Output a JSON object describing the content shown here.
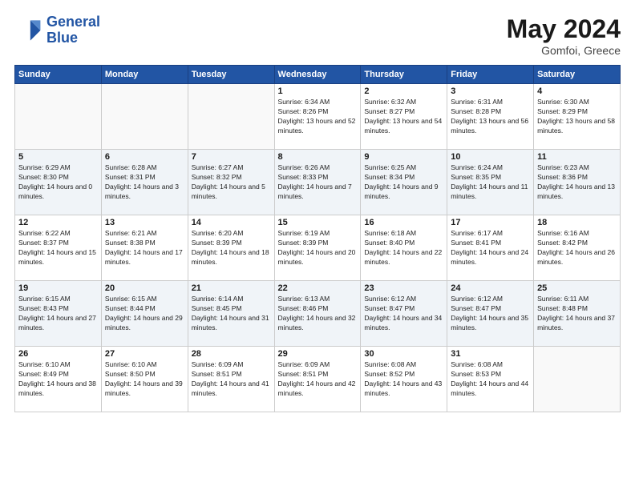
{
  "header": {
    "logo_line1": "General",
    "logo_line2": "Blue",
    "month_year": "May 2024",
    "location": "Gomfoi, Greece"
  },
  "days_of_week": [
    "Sunday",
    "Monday",
    "Tuesday",
    "Wednesday",
    "Thursday",
    "Friday",
    "Saturday"
  ],
  "weeks": [
    [
      {
        "day": "",
        "sunrise": "",
        "sunset": "",
        "daylight": "",
        "empty": true
      },
      {
        "day": "",
        "sunrise": "",
        "sunset": "",
        "daylight": "",
        "empty": true
      },
      {
        "day": "",
        "sunrise": "",
        "sunset": "",
        "daylight": "",
        "empty": true
      },
      {
        "day": "1",
        "sunrise": "Sunrise: 6:34 AM",
        "sunset": "Sunset: 8:26 PM",
        "daylight": "Daylight: 13 hours and 52 minutes."
      },
      {
        "day": "2",
        "sunrise": "Sunrise: 6:32 AM",
        "sunset": "Sunset: 8:27 PM",
        "daylight": "Daylight: 13 hours and 54 minutes."
      },
      {
        "day": "3",
        "sunrise": "Sunrise: 6:31 AM",
        "sunset": "Sunset: 8:28 PM",
        "daylight": "Daylight: 13 hours and 56 minutes."
      },
      {
        "day": "4",
        "sunrise": "Sunrise: 6:30 AM",
        "sunset": "Sunset: 8:29 PM",
        "daylight": "Daylight: 13 hours and 58 minutes."
      }
    ],
    [
      {
        "day": "5",
        "sunrise": "Sunrise: 6:29 AM",
        "sunset": "Sunset: 8:30 PM",
        "daylight": "Daylight: 14 hours and 0 minutes."
      },
      {
        "day": "6",
        "sunrise": "Sunrise: 6:28 AM",
        "sunset": "Sunset: 8:31 PM",
        "daylight": "Daylight: 14 hours and 3 minutes."
      },
      {
        "day": "7",
        "sunrise": "Sunrise: 6:27 AM",
        "sunset": "Sunset: 8:32 PM",
        "daylight": "Daylight: 14 hours and 5 minutes."
      },
      {
        "day": "8",
        "sunrise": "Sunrise: 6:26 AM",
        "sunset": "Sunset: 8:33 PM",
        "daylight": "Daylight: 14 hours and 7 minutes."
      },
      {
        "day": "9",
        "sunrise": "Sunrise: 6:25 AM",
        "sunset": "Sunset: 8:34 PM",
        "daylight": "Daylight: 14 hours and 9 minutes."
      },
      {
        "day": "10",
        "sunrise": "Sunrise: 6:24 AM",
        "sunset": "Sunset: 8:35 PM",
        "daylight": "Daylight: 14 hours and 11 minutes."
      },
      {
        "day": "11",
        "sunrise": "Sunrise: 6:23 AM",
        "sunset": "Sunset: 8:36 PM",
        "daylight": "Daylight: 14 hours and 13 minutes."
      }
    ],
    [
      {
        "day": "12",
        "sunrise": "Sunrise: 6:22 AM",
        "sunset": "Sunset: 8:37 PM",
        "daylight": "Daylight: 14 hours and 15 minutes."
      },
      {
        "day": "13",
        "sunrise": "Sunrise: 6:21 AM",
        "sunset": "Sunset: 8:38 PM",
        "daylight": "Daylight: 14 hours and 17 minutes."
      },
      {
        "day": "14",
        "sunrise": "Sunrise: 6:20 AM",
        "sunset": "Sunset: 8:39 PM",
        "daylight": "Daylight: 14 hours and 18 minutes."
      },
      {
        "day": "15",
        "sunrise": "Sunrise: 6:19 AM",
        "sunset": "Sunset: 8:39 PM",
        "daylight": "Daylight: 14 hours and 20 minutes."
      },
      {
        "day": "16",
        "sunrise": "Sunrise: 6:18 AM",
        "sunset": "Sunset: 8:40 PM",
        "daylight": "Daylight: 14 hours and 22 minutes."
      },
      {
        "day": "17",
        "sunrise": "Sunrise: 6:17 AM",
        "sunset": "Sunset: 8:41 PM",
        "daylight": "Daylight: 14 hours and 24 minutes."
      },
      {
        "day": "18",
        "sunrise": "Sunrise: 6:16 AM",
        "sunset": "Sunset: 8:42 PM",
        "daylight": "Daylight: 14 hours and 26 minutes."
      }
    ],
    [
      {
        "day": "19",
        "sunrise": "Sunrise: 6:15 AM",
        "sunset": "Sunset: 8:43 PM",
        "daylight": "Daylight: 14 hours and 27 minutes."
      },
      {
        "day": "20",
        "sunrise": "Sunrise: 6:15 AM",
        "sunset": "Sunset: 8:44 PM",
        "daylight": "Daylight: 14 hours and 29 minutes."
      },
      {
        "day": "21",
        "sunrise": "Sunrise: 6:14 AM",
        "sunset": "Sunset: 8:45 PM",
        "daylight": "Daylight: 14 hours and 31 minutes."
      },
      {
        "day": "22",
        "sunrise": "Sunrise: 6:13 AM",
        "sunset": "Sunset: 8:46 PM",
        "daylight": "Daylight: 14 hours and 32 minutes."
      },
      {
        "day": "23",
        "sunrise": "Sunrise: 6:12 AM",
        "sunset": "Sunset: 8:47 PM",
        "daylight": "Daylight: 14 hours and 34 minutes."
      },
      {
        "day": "24",
        "sunrise": "Sunrise: 6:12 AM",
        "sunset": "Sunset: 8:47 PM",
        "daylight": "Daylight: 14 hours and 35 minutes."
      },
      {
        "day": "25",
        "sunrise": "Sunrise: 6:11 AM",
        "sunset": "Sunset: 8:48 PM",
        "daylight": "Daylight: 14 hours and 37 minutes."
      }
    ],
    [
      {
        "day": "26",
        "sunrise": "Sunrise: 6:10 AM",
        "sunset": "Sunset: 8:49 PM",
        "daylight": "Daylight: 14 hours and 38 minutes."
      },
      {
        "day": "27",
        "sunrise": "Sunrise: 6:10 AM",
        "sunset": "Sunset: 8:50 PM",
        "daylight": "Daylight: 14 hours and 39 minutes."
      },
      {
        "day": "28",
        "sunrise": "Sunrise: 6:09 AM",
        "sunset": "Sunset: 8:51 PM",
        "daylight": "Daylight: 14 hours and 41 minutes."
      },
      {
        "day": "29",
        "sunrise": "Sunrise: 6:09 AM",
        "sunset": "Sunset: 8:51 PM",
        "daylight": "Daylight: 14 hours and 42 minutes."
      },
      {
        "day": "30",
        "sunrise": "Sunrise: 6:08 AM",
        "sunset": "Sunset: 8:52 PM",
        "daylight": "Daylight: 14 hours and 43 minutes."
      },
      {
        "day": "31",
        "sunrise": "Sunrise: 6:08 AM",
        "sunset": "Sunset: 8:53 PM",
        "daylight": "Daylight: 14 hours and 44 minutes."
      },
      {
        "day": "",
        "sunrise": "",
        "sunset": "",
        "daylight": "",
        "empty": true
      }
    ]
  ]
}
